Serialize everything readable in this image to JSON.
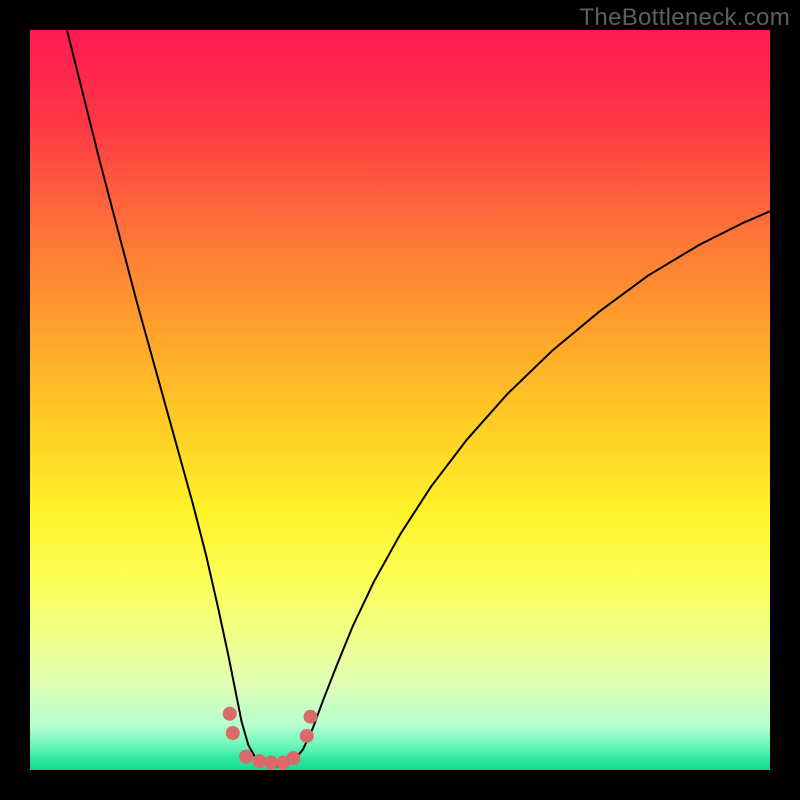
{
  "watermark": {
    "text": "TheBottleneck.com"
  },
  "chart_data": {
    "type": "line",
    "title": "",
    "xlabel": "",
    "ylabel": "",
    "xlim": [
      0,
      100
    ],
    "ylim": [
      0,
      100
    ],
    "valley_x": 33,
    "valley_width": 9,
    "gradient_stops": [
      {
        "offset": 0.0,
        "color": "#ff1a52"
      },
      {
        "offset": 0.12,
        "color": "#ff3545"
      },
      {
        "offset": 0.25,
        "color": "#ff6a3a"
      },
      {
        "offset": 0.38,
        "color": "#ff9a2f"
      },
      {
        "offset": 0.52,
        "color": "#ffc825"
      },
      {
        "offset": 0.65,
        "color": "#fff228"
      },
      {
        "offset": 0.74,
        "color": "#fcff55"
      },
      {
        "offset": 0.82,
        "color": "#f1ff88"
      },
      {
        "offset": 0.88,
        "color": "#e1ffb3"
      },
      {
        "offset": 0.94,
        "color": "#b6ffd1"
      },
      {
        "offset": 0.969,
        "color": "#67f5b8"
      },
      {
        "offset": 0.986,
        "color": "#2ae69d"
      },
      {
        "offset": 1.0,
        "color": "#13dc8e"
      }
    ],
    "series": [
      {
        "name": "bottleneck-curve",
        "stroke": "#000000",
        "stroke_width": 2,
        "points": [
          {
            "x": 5.0,
            "y": 100.0
          },
          {
            "x": 7.0,
            "y": 92.0
          },
          {
            "x": 9.5,
            "y": 82.0
          },
          {
            "x": 12.0,
            "y": 72.5
          },
          {
            "x": 14.5,
            "y": 63.0
          },
          {
            "x": 17.0,
            "y": 54.0
          },
          {
            "x": 19.5,
            "y": 45.0
          },
          {
            "x": 22.0,
            "y": 36.0
          },
          {
            "x": 23.8,
            "y": 29.0
          },
          {
            "x": 25.4,
            "y": 22.0
          },
          {
            "x": 26.8,
            "y": 15.5
          },
          {
            "x": 27.8,
            "y": 10.5
          },
          {
            "x": 28.6,
            "y": 6.5
          },
          {
            "x": 29.5,
            "y": 3.4
          },
          {
            "x": 30.6,
            "y": 1.4
          },
          {
            "x": 32.2,
            "y": 0.5
          },
          {
            "x": 34.0,
            "y": 0.5
          },
          {
            "x": 35.6,
            "y": 1.2
          },
          {
            "x": 36.9,
            "y": 2.8
          },
          {
            "x": 38.2,
            "y": 5.6
          },
          {
            "x": 39.6,
            "y": 9.4
          },
          {
            "x": 41.4,
            "y": 14.0
          },
          {
            "x": 43.6,
            "y": 19.4
          },
          {
            "x": 46.5,
            "y": 25.5
          },
          {
            "x": 50.0,
            "y": 31.8
          },
          {
            "x": 54.2,
            "y": 38.3
          },
          {
            "x": 59.0,
            "y": 44.6
          },
          {
            "x": 64.5,
            "y": 50.8
          },
          {
            "x": 70.5,
            "y": 56.6
          },
          {
            "x": 77.0,
            "y": 62.0
          },
          {
            "x": 83.5,
            "y": 66.8
          },
          {
            "x": 90.5,
            "y": 71.0
          },
          {
            "x": 96.5,
            "y": 74.0
          },
          {
            "x": 100.0,
            "y": 75.5
          }
        ]
      }
    ],
    "markers": {
      "color": "#d96a6a",
      "radius": 7,
      "points": [
        {
          "x": 27.0,
          "y": 7.6
        },
        {
          "x": 27.4,
          "y": 5.0
        },
        {
          "x": 29.2,
          "y": 1.8
        },
        {
          "x": 31.0,
          "y": 1.2
        },
        {
          "x": 32.6,
          "y": 1.0
        },
        {
          "x": 34.2,
          "y": 1.0
        },
        {
          "x": 35.6,
          "y": 1.6
        },
        {
          "x": 37.4,
          "y": 4.6
        },
        {
          "x": 37.9,
          "y": 7.2
        }
      ]
    }
  }
}
